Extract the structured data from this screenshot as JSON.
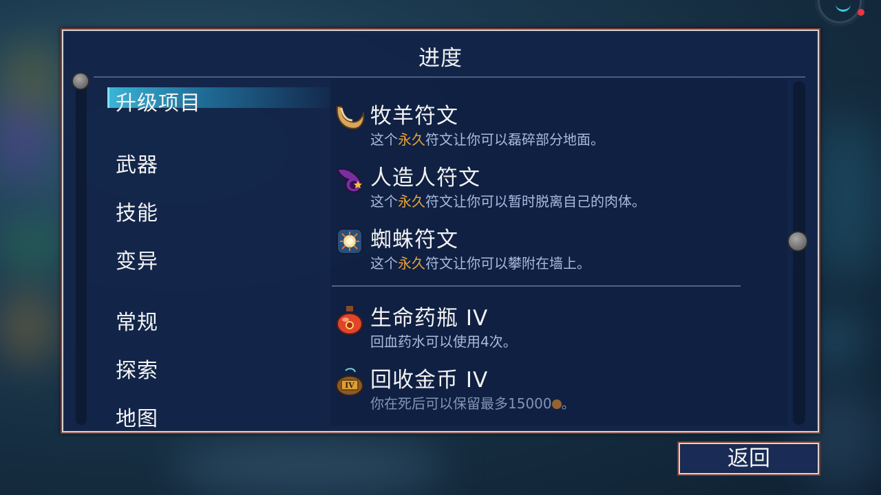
{
  "panel": {
    "title": "进度"
  },
  "categories": [
    {
      "label": "升级项目",
      "selected": true
    },
    {
      "label": "武器",
      "selected": false
    },
    {
      "label": "技能",
      "selected": false
    },
    {
      "label": "变异",
      "selected": false
    },
    {
      "label": "常规",
      "selected": false
    },
    {
      "label": "探索",
      "selected": false
    },
    {
      "label": "地图",
      "selected": false
    }
  ],
  "items": [
    {
      "icon": "ram-horn-rune-icon",
      "name": "牧羊符文",
      "desc_pre": "这个",
      "desc_hl": "永久",
      "desc_post": "符文让你可以磊碎部分地面。"
    },
    {
      "icon": "homunculus-rune-icon",
      "name": "人造人符文",
      "desc_pre": "这个",
      "desc_hl": "永久",
      "desc_post": "符文让你可以暂时脱离自己的肉体。"
    },
    {
      "icon": "spider-rune-icon",
      "name": "蜘蛛符文",
      "desc_pre": "这个",
      "desc_hl": "永久",
      "desc_post": "符文让你可以攀附在墙上。"
    },
    {
      "icon": "health-flask-icon",
      "name": "生命药瓶 IV",
      "desc": "回血药水可以使用4次。"
    },
    {
      "icon": "gold-recovery-icon",
      "name": "回收金币 IV",
      "desc_pre": "你在死后可以保留最多15000",
      "desc_post": "。"
    }
  ],
  "colors": {
    "highlight": "#e8a23a",
    "desc": "#a8bbe0",
    "selected_bar": "#3bb4d6",
    "border": "#8a3a30"
  },
  "back_button": {
    "label": "返回"
  }
}
